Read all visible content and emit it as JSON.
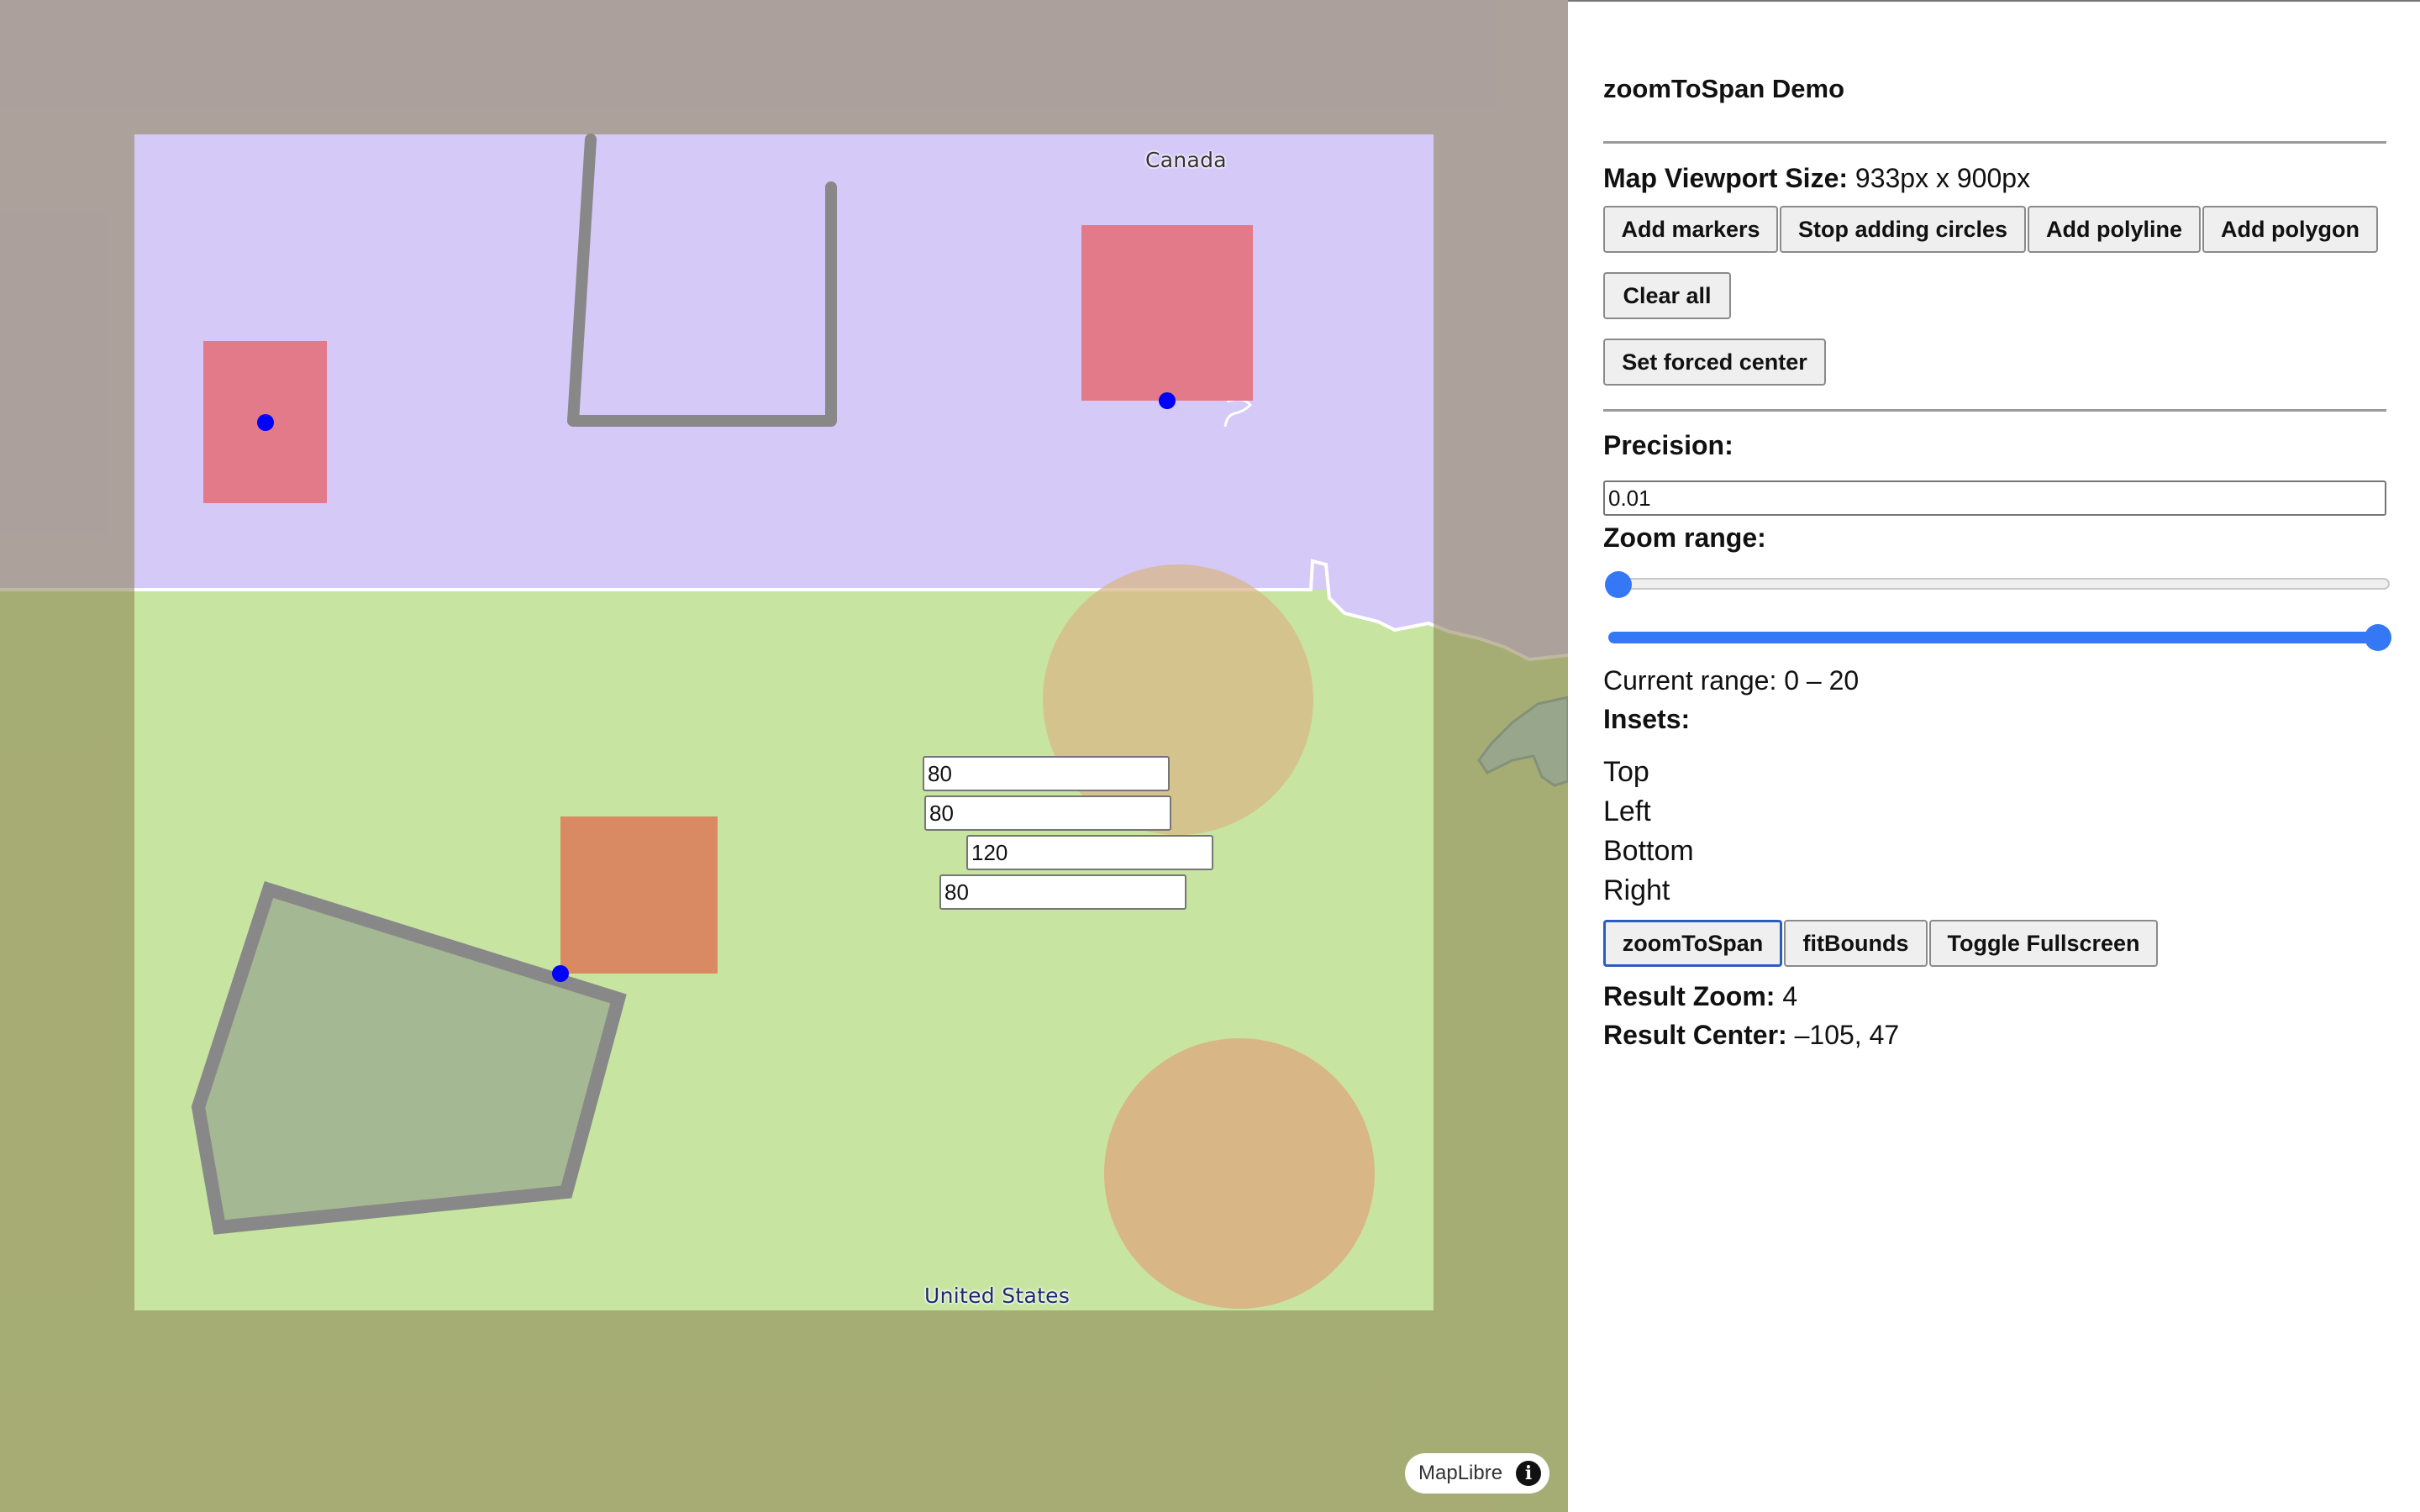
{
  "map": {
    "labels": {
      "canada": "Canada",
      "united_states": "United States"
    },
    "attribution": "MapLibre",
    "colors": {
      "canada_fill": "#d4c9f7",
      "us_fill": "#c8e4a1",
      "inset_overlay": "#8a7f50",
      "marker": "#0000ff",
      "rect_fill": "#e37a8a",
      "orange_rect": "#da8a62",
      "circle_fill": "#d9b685",
      "line_stroke": "#888888",
      "polygon_fill": "#a4b893"
    }
  },
  "panel": {
    "title": "zoomToSpan Demo",
    "viewport": {
      "label": "Map Viewport Size:",
      "value": "933px x 900px"
    },
    "buttons": {
      "add_markers": "Add markers",
      "stop_circles": "Stop adding circles",
      "add_polyline": "Add polyline",
      "add_polygon": "Add polygon",
      "clear_all": "Clear all",
      "set_forced_center": "Set forced center"
    },
    "precision": {
      "label": "Precision:",
      "value": "0.01"
    },
    "zoom_range": {
      "label": "Zoom range:",
      "min": 0,
      "max": 20,
      "current_label": "Current range: 0 – 20"
    },
    "insets": {
      "label": "Insets:",
      "top_label": "Top",
      "top_value": "80",
      "left_label": "Left",
      "left_value": "80",
      "bottom_label": "Bottom",
      "bottom_value": "120",
      "right_label": "Right",
      "right_value": "80"
    },
    "actions": {
      "zoom_to_span": "zoomToSpan",
      "fit_bounds": "fitBounds",
      "toggle_fullscreen": "Toggle Fullscreen"
    },
    "result": {
      "zoom_label": "Result Zoom:",
      "zoom_value": "4",
      "center_label": "Result Center:",
      "center_value": "–105, 47"
    }
  }
}
